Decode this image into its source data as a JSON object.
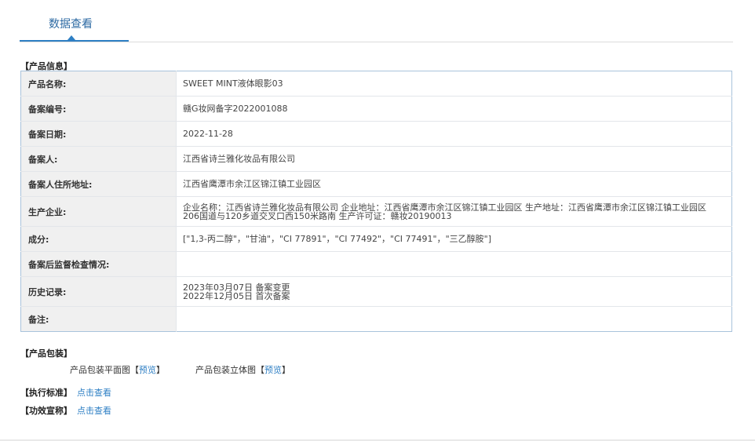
{
  "tab": {
    "label": "数据查看"
  },
  "sections": {
    "product_info": "产品信息",
    "product_package": "产品包装",
    "standard": "执行标准",
    "efficacy": "功效宣称"
  },
  "table": [
    {
      "key": "产品名称:",
      "value": [
        "SWEET MINT液体眼影03"
      ]
    },
    {
      "key": "备案编号:",
      "value": [
        "赣G妆网备字2022001088"
      ]
    },
    {
      "key": "备案日期:",
      "value": [
        "2022-11-28"
      ]
    },
    {
      "key": "备案人:",
      "value": [
        "江西省诗兰雅化妆品有限公司"
      ]
    },
    {
      "key": "备案人住所地址:",
      "value": [
        "江西省鹰潭市余江区锦江镇工业园区"
      ]
    },
    {
      "key": "生产企业:",
      "value": [
        "企业名称：江西省诗兰雅化妆品有限公司 企业地址：江西省鹰潭市余江区锦江镇工业园区 生产地址：江西省鹰潭市余江区锦江镇工业园区",
        "206国道与120乡道交叉口西150米路南 生产许可证：赣妆20190013"
      ]
    },
    {
      "key": "成分:",
      "value": [
        "[\"1,3-丙二醇\"，\"甘油\"，\"CI 77891\"，\"CI 77492\"，\"CI 77491\"，\"三乙醇胺\"]"
      ]
    },
    {
      "key": "备案后监督检查情况:",
      "value": [
        ""
      ]
    },
    {
      "key": "历史记录:",
      "value": [
        "2023年03月07日 备案变更",
        "2022年12月05日 首次备案"
      ]
    },
    {
      "key": "备注:",
      "value": [
        ""
      ]
    }
  ],
  "package": {
    "flat_label": "产品包装平面图",
    "three_d_label": "产品包装立体图",
    "preview": "预览",
    "bracket_open": "【",
    "bracket_close": "】"
  },
  "links": {
    "view": "点击查看"
  },
  "colors": {
    "accent": "#2e7fc4",
    "label_bg": "#f0f0f0",
    "border": "#a9c3dc"
  }
}
